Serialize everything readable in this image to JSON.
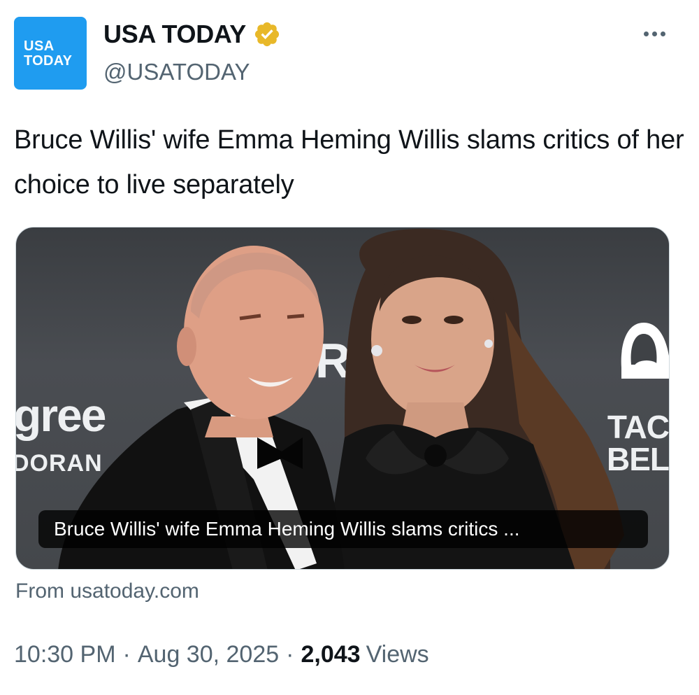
{
  "author": {
    "avatar_line1": "USA",
    "avatar_line2": "TODAY",
    "display_name": "USA TODAY",
    "handle": "@USATODAY",
    "verified_badge_color": "#e8b829"
  },
  "tweet": {
    "text": "Bruce Willis' wife Emma Heming Willis slams critics of her choice to live separately"
  },
  "card": {
    "caption": "Bruce Willis' wife Emma Heming Willis slams critics ...",
    "source": "From usatoday.com",
    "backdrop": {
      "gree": "gree",
      "dorant": "DORAN",
      "ro": "RC",
      "taco_line1": "TAC",
      "taco_line2": "BEL"
    }
  },
  "meta": {
    "time": "10:30 PM",
    "separator": "·",
    "date": "Aug 30, 2025",
    "views_count": "2,043",
    "views_label": "Views"
  },
  "colors": {
    "brand_blue": "#1f9cf0",
    "text_primary": "#0f1419",
    "text_secondary": "#536471"
  }
}
